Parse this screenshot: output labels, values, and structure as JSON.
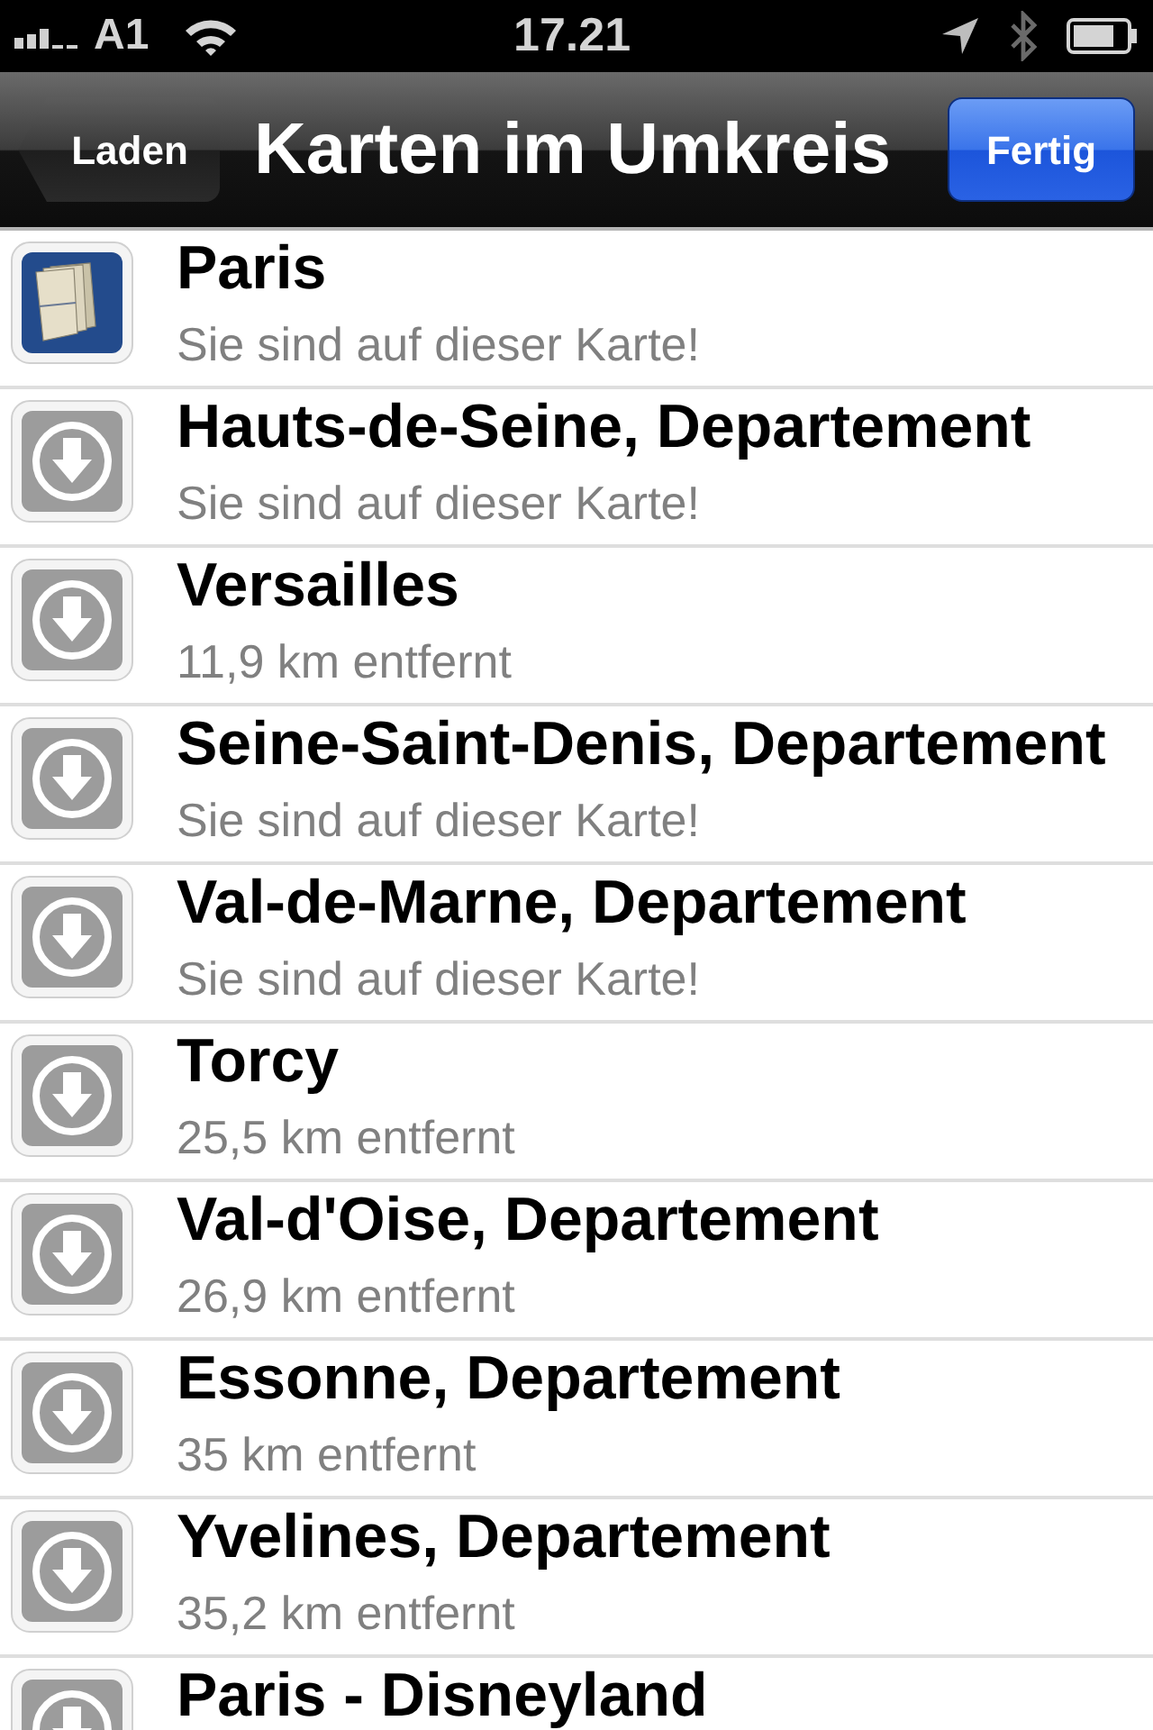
{
  "status_bar": {
    "carrier": "A1",
    "time": "17.21"
  },
  "nav_bar": {
    "back_button": "Laden",
    "title": "Karten im Umkreis",
    "done_button": "Fertig"
  },
  "maps": [
    {
      "kind": "map",
      "name": "Paris",
      "detail": "Sie sind auf dieser Karte!"
    },
    {
      "kind": "download",
      "name": "Hauts-de-Seine, Departement",
      "detail": "Sie sind auf dieser Karte!"
    },
    {
      "kind": "download",
      "name": "Versailles",
      "detail": "11,9 km entfernt"
    },
    {
      "kind": "download",
      "name": "Seine-Saint-Denis, Departement",
      "detail": "Sie sind auf dieser Karte!"
    },
    {
      "kind": "download",
      "name": "Val-de-Marne, Departement",
      "detail": "Sie sind auf dieser Karte!"
    },
    {
      "kind": "download",
      "name": "Torcy",
      "detail": "25,5 km entfernt"
    },
    {
      "kind": "download",
      "name": "Val-d'Oise, Departement",
      "detail": "26,9 km entfernt"
    },
    {
      "kind": "download",
      "name": "Essonne, Departement",
      "detail": "35 km entfernt"
    },
    {
      "kind": "download",
      "name": "Yvelines, Departement",
      "detail": "35,2 km entfernt"
    },
    {
      "kind": "download",
      "name": "Paris - Disneyland"
    }
  ]
}
